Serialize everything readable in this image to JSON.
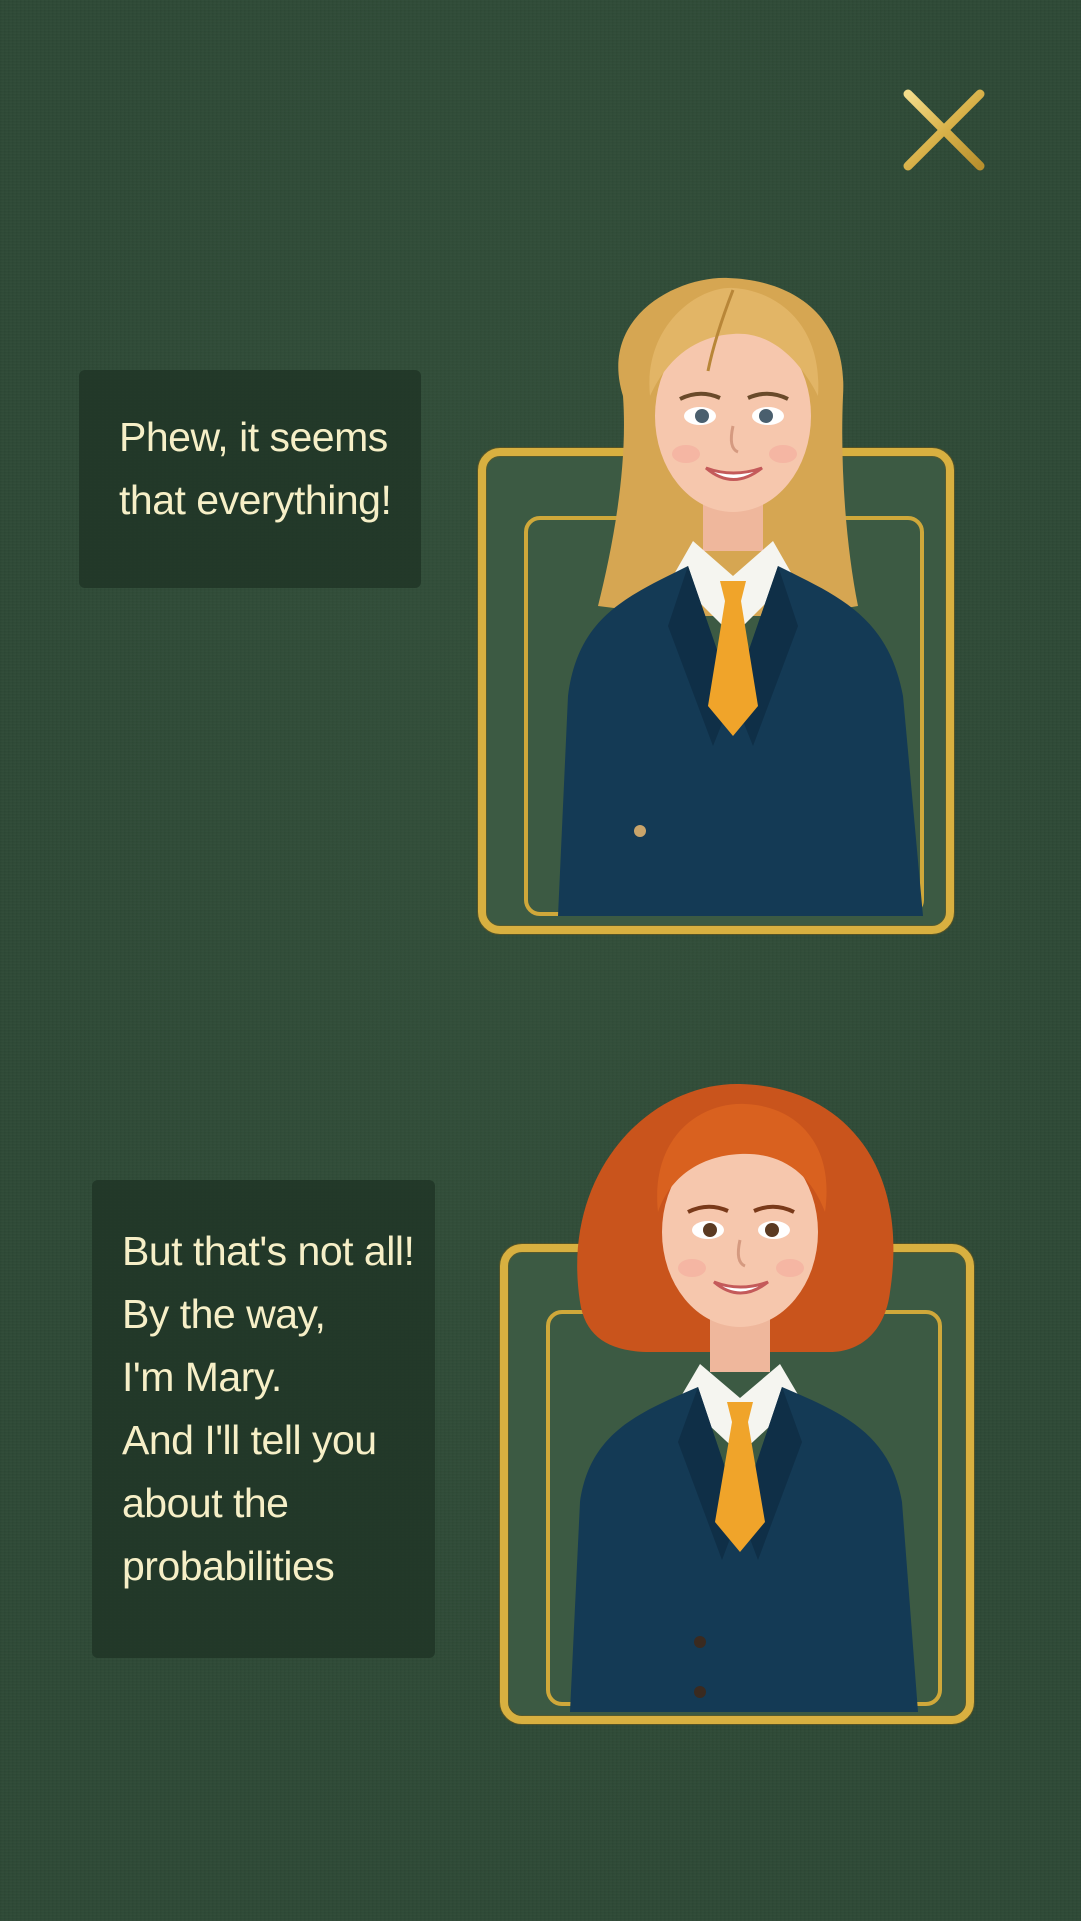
{
  "dialog": {
    "close_icon": "close-icon",
    "colors": {
      "background": "#2e4936",
      "bubble": "#20342699",
      "text": "#f6efc7",
      "gold": "#d8b040"
    }
  },
  "messages": [
    {
      "speaker_image": "blonde-woman-in-suit",
      "lines": [
        "Phew, it seems",
        "that everything!"
      ]
    },
    {
      "speaker_image": "red-haired-woman-in-suit",
      "lines": [
        "But that's not all!",
        "By the way,",
        "I'm Mary.",
        "And I'll tell you",
        "about the",
        "probabilities"
      ]
    }
  ]
}
